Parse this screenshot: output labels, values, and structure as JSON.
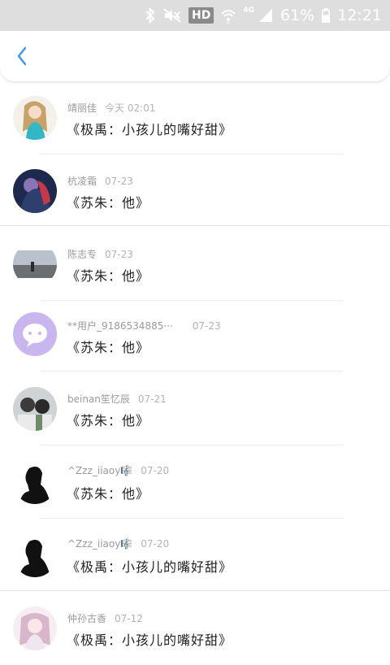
{
  "status_bar": {
    "hd": "HD",
    "network": "4G",
    "battery_percent": "61%",
    "time": "12:21",
    "icons": [
      "bluetooth-icon",
      "mute-icon",
      "wifi-icon",
      "signal-icon",
      "battery-icon"
    ]
  },
  "header": {
    "back_icon": "chevron-left-icon",
    "accent": "#3d9be9"
  },
  "comments": [
    {
      "name": "靖丽佳",
      "date": "今天 02:01",
      "title": "《极禹：小孩儿的嘴好甜》"
    },
    {
      "name": "杭凌霜",
      "date": "07-23",
      "title": "《苏朱：他》"
    },
    {
      "name": "陈志专",
      "date": "07-23",
      "title": "《苏朱：他》"
    },
    {
      "name": "**用户_9186534885···",
      "date": "07-23",
      "title": "《苏朱：他》"
    },
    {
      "name": "beinan笙忆辰",
      "date": "07-21",
      "title": "《苏朱：他》"
    },
    {
      "name": "^Zzz_iiaoy🎼",
      "date": "07-20",
      "title": "《苏朱：他》"
    },
    {
      "name": "^Zzz_iiaoy🎼",
      "date": "07-20",
      "title": "《极禹：小孩儿的嘴好甜》"
    },
    {
      "name": "仲孙古香",
      "date": "07-12",
      "title": "《极禹：小孩儿的嘴好甜》"
    }
  ]
}
